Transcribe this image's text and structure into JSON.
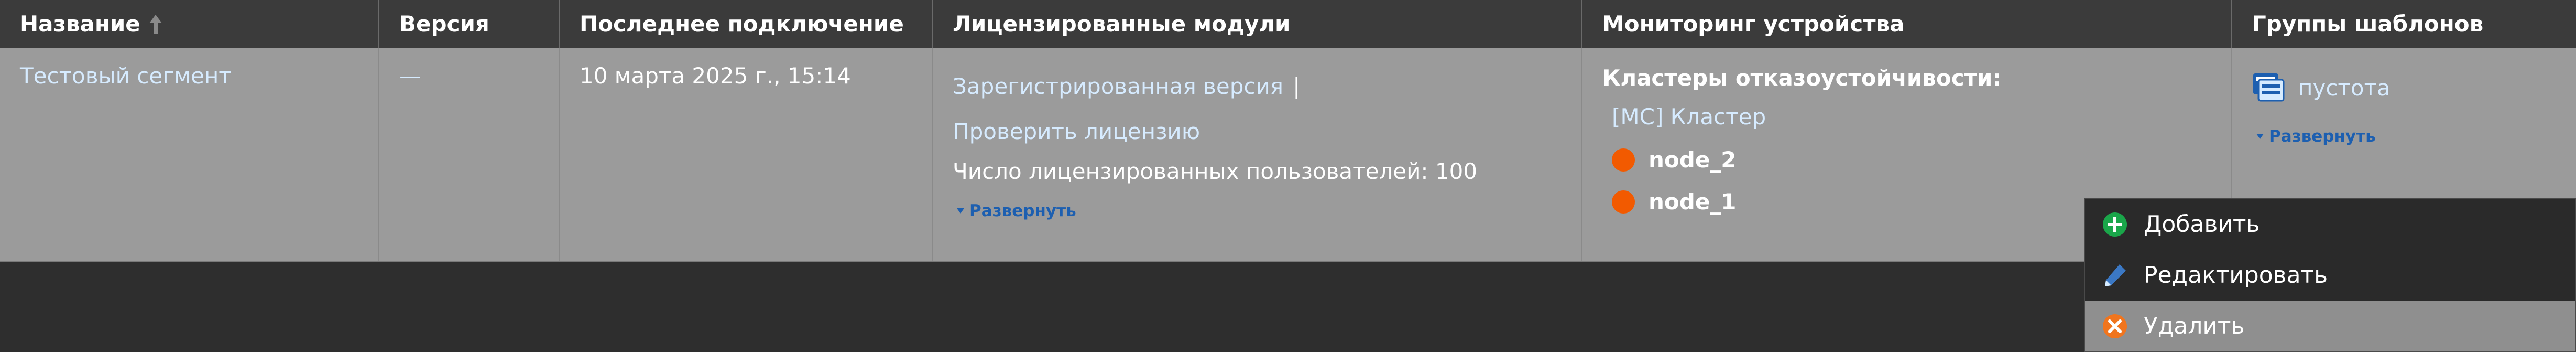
{
  "header": {
    "columns": [
      "Название",
      "Версия",
      "Последнее подключение",
      "Лицензированные модули",
      "Мониторинг устройства",
      "Группы шаблонов"
    ]
  },
  "row": {
    "name": "Тестовый сегмент",
    "version": "—",
    "last_connection": "10 марта 2025 г., 15:14",
    "licenses": {
      "registered_link": "Зарегистрированная версия",
      "separator": "|",
      "check_link": "Проверить лицензию",
      "users_text": "Число лицензированных пользователей: 100",
      "expand": "Развернуть"
    },
    "monitoring": {
      "title": "Кластеры отказоустойчивости:",
      "cluster": "[MC] Кластер",
      "nodes": [
        "node_2",
        "node_1"
      ],
      "status_color": "#f25a00"
    },
    "templates": {
      "group": "пустота",
      "expand": "Развернуть"
    }
  },
  "context_menu": {
    "items": [
      {
        "label": "Добавить",
        "icon": "plus-circle-icon"
      },
      {
        "label": "Редактировать",
        "icon": "pencil-icon"
      },
      {
        "label": "Удалить",
        "icon": "x-circle-icon"
      }
    ]
  },
  "colors": {
    "header_bg": "#3b3b3b",
    "row_bg": "#9b9b9b",
    "link": "#d6ebff",
    "small_link": "#1d5fb0",
    "add_green": "#1aa64a",
    "delete_orange": "#f0751e",
    "edit_blue": "#3b78c4"
  }
}
